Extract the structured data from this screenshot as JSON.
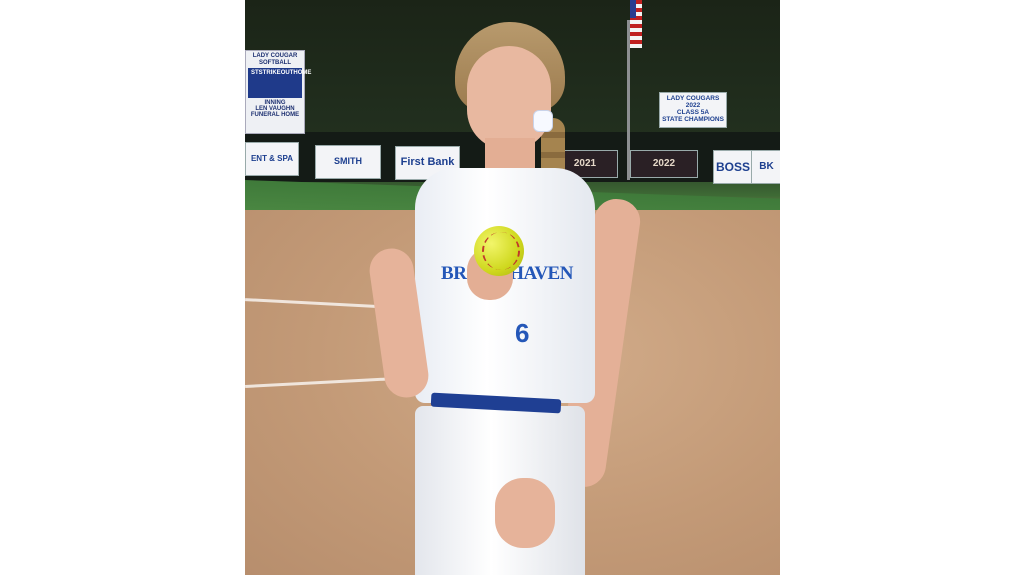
{
  "photo": {
    "scoreboard": {
      "title_line1": "LADY COUGAR",
      "title_line2": "SOFTBALL",
      "strike": "STRIKE",
      "out": "OUT",
      "st": "ST",
      "home": "HOME",
      "inning": "INNING",
      "sponsor_line1": "LEN VAUGHN",
      "sponsor_line2": "FUNERAL HOME"
    },
    "signs": {
      "champions_line1": "LADY COUGARS",
      "champions_line2": "2022",
      "champions_line3": "CLASS 5A",
      "champions_line4": "STATE CHAMPIONS",
      "sign_ent_spa": "ENT & SPA",
      "sign_smith": "SMITH",
      "sign_first_bank": "First Bank",
      "sign_2021": "2021",
      "sign_2022": "2022",
      "sign_boss": "BOSS",
      "sign_bk": "BK"
    },
    "jersey": {
      "team_name": "BROOKHAVEN",
      "number": "6"
    }
  }
}
